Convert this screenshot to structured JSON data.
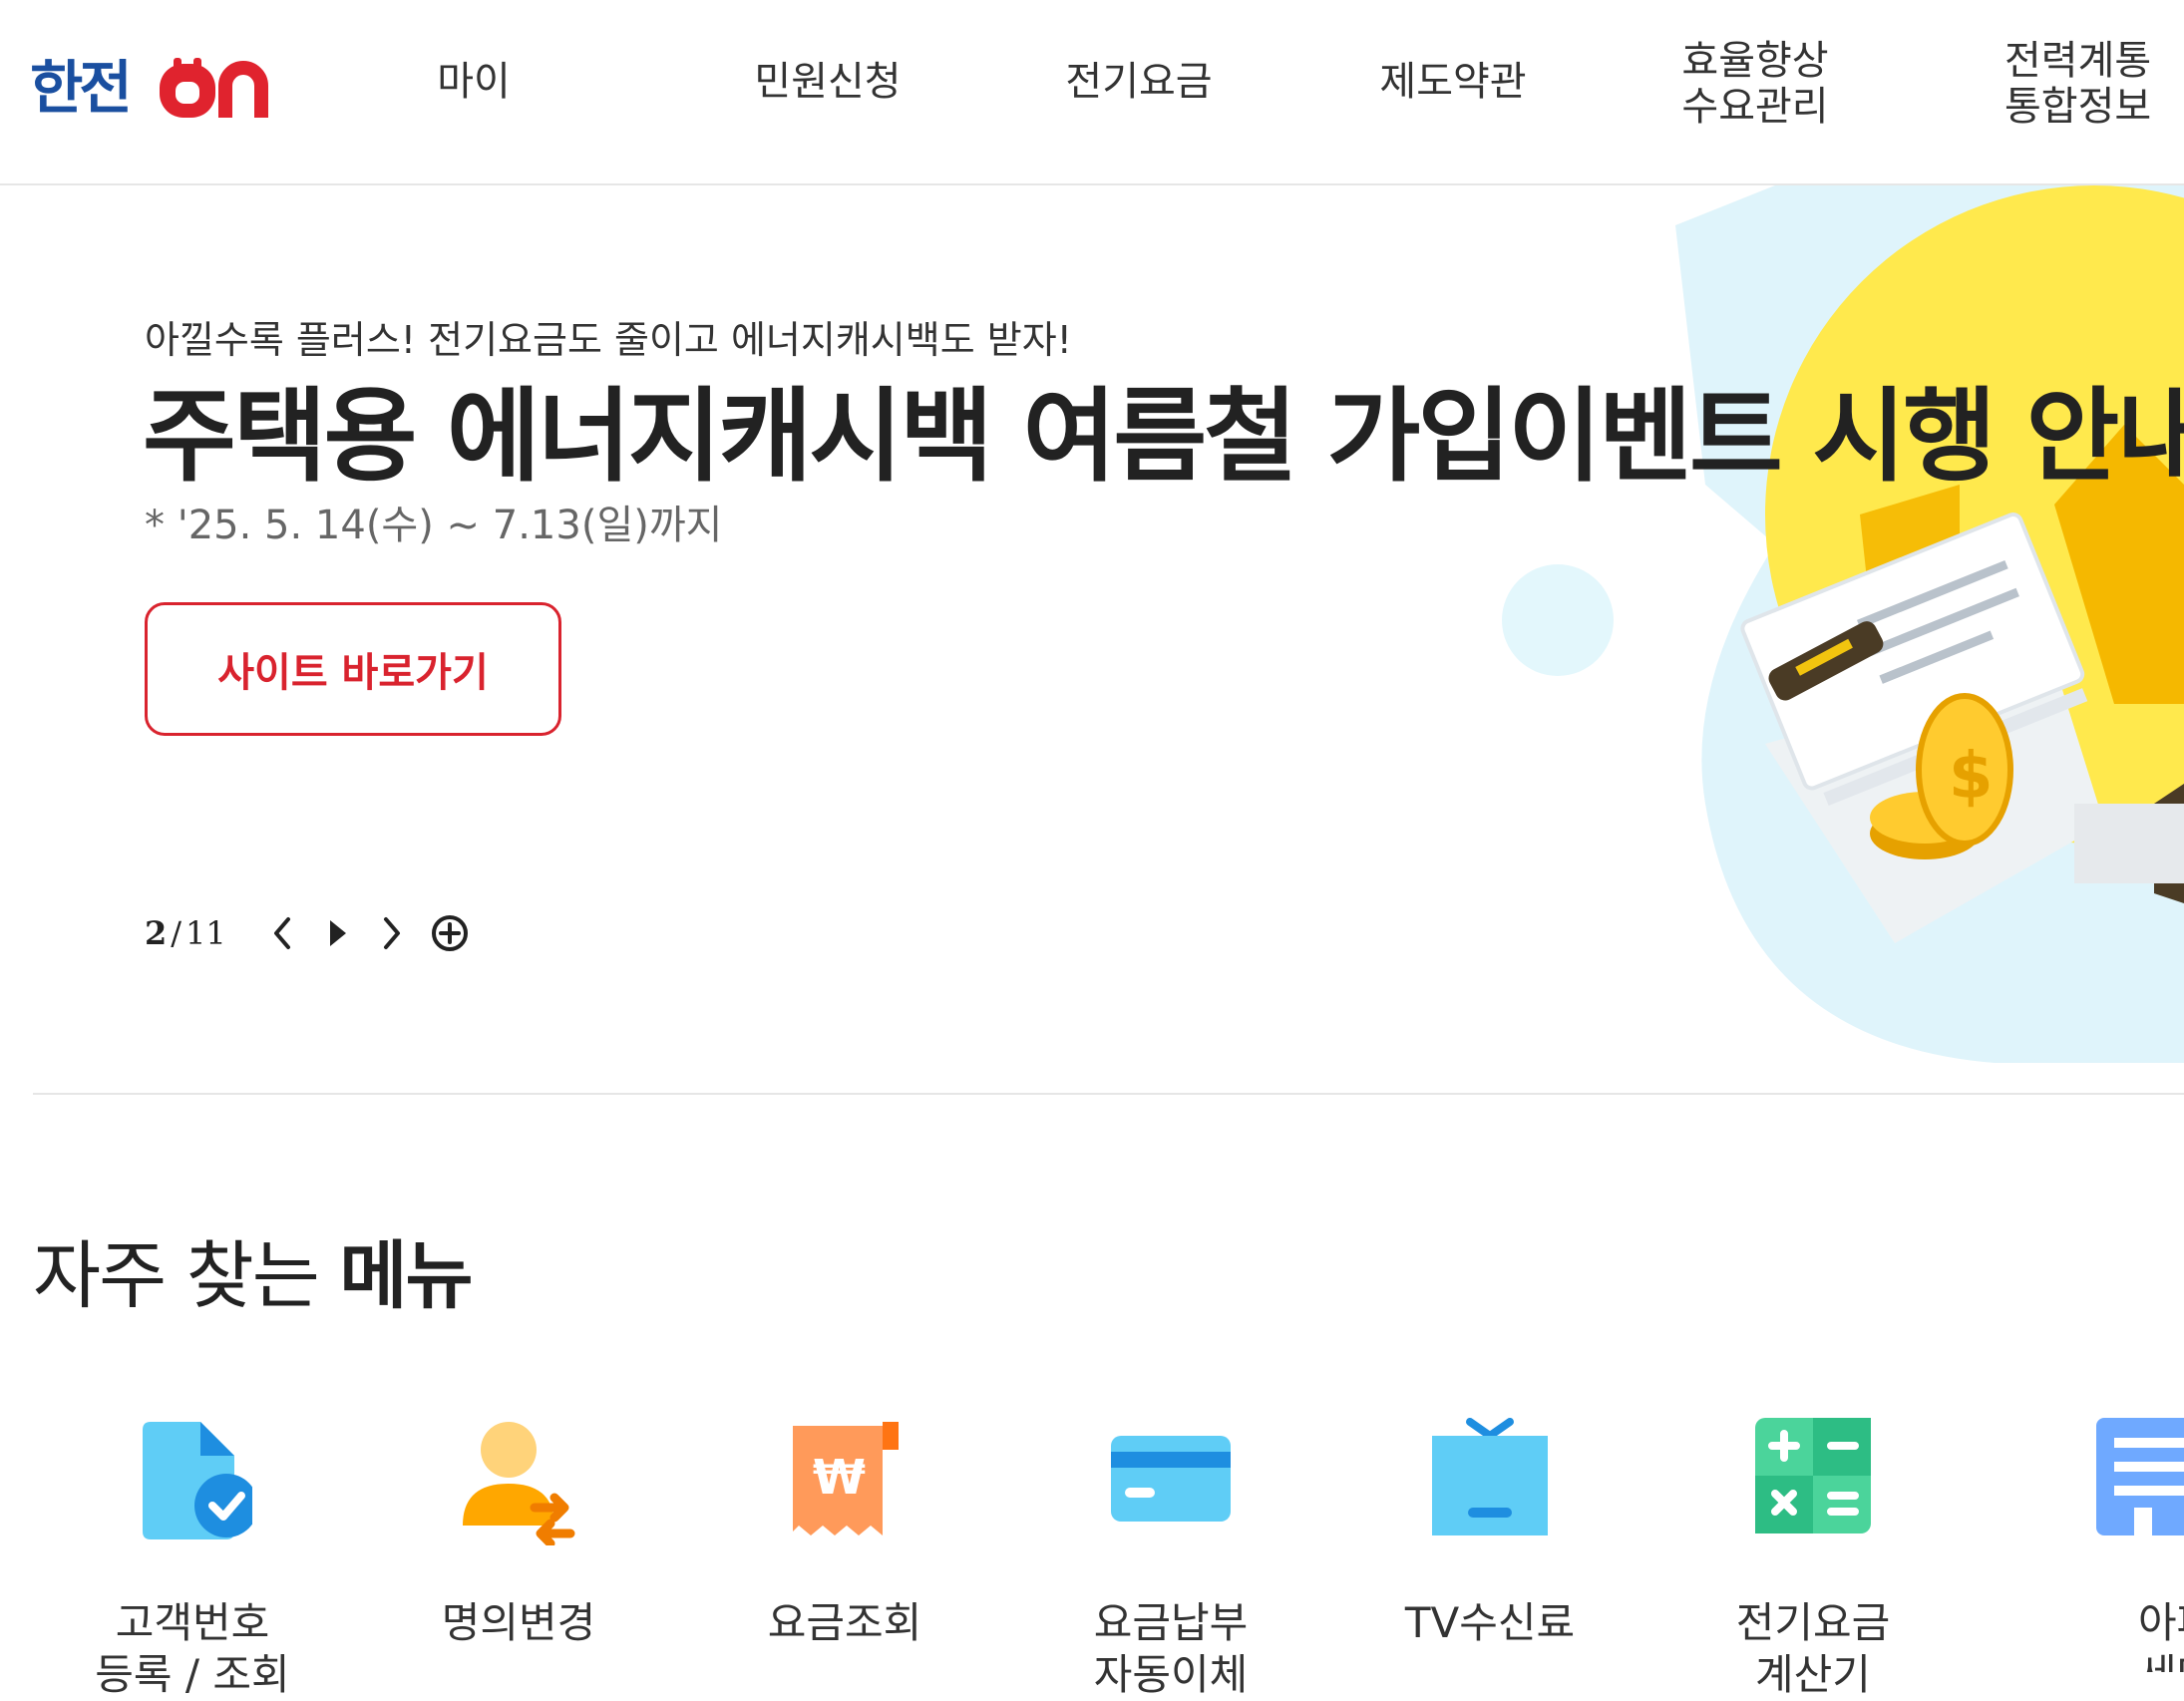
{
  "header": {
    "logo_text": "한전ON",
    "nav": [
      {
        "label": "마이"
      },
      {
        "label": "민원신청"
      },
      {
        "label": "전기요금"
      },
      {
        "label": "제도약관"
      },
      {
        "label": "효율향상 수요관리",
        "lines": [
          "효율향상",
          "수요관리"
        ]
      },
      {
        "label": "전력계통 통합정보",
        "lines": [
          "전력계통",
          "통합정보"
        ]
      }
    ]
  },
  "hero": {
    "subtitle": "아낄수록 플러스! 전기요금도 줄이고 에너지캐시백도 받자!",
    "title": "주택용 에너지캐시백 여름철 가입이벤트 시행 안내",
    "date": "* '25. 5. 14(수) ~ 7.13(일)까지",
    "cta_label": "사이트 바로가기",
    "pager": {
      "current": "2",
      "separator": "/",
      "total": "11"
    }
  },
  "frequent": {
    "title_plain": "자주 찾는 ",
    "title_bold": "메뉴",
    "items": [
      {
        "lines": [
          "고객번호",
          "등록 / 조회"
        ],
        "icon": "document-check-icon"
      },
      {
        "lines": [
          "명의변경",
          ""
        ],
        "icon": "person-swap-icon"
      },
      {
        "lines": [
          "요금조회",
          ""
        ],
        "icon": "won-receipt-icon"
      },
      {
        "lines": [
          "요금납부",
          "자동이체"
        ],
        "icon": "credit-card-icon"
      },
      {
        "lines": [
          "TV수신료",
          ""
        ],
        "icon": "tv-icon"
      },
      {
        "lines": [
          "전기요금",
          "계산기"
        ],
        "icon": "calculator-icon"
      },
      {
        "lines": [
          "아파트",
          "세대도"
        ],
        "icon": "apartment-icon"
      }
    ]
  },
  "colors": {
    "accent_red": "#d9232e",
    "logo_blue": "#1a4fa0",
    "logo_red": "#e0232e",
    "hero_bg_blue": "#dff4fb",
    "bulb_yellow": "#ffe94d"
  }
}
